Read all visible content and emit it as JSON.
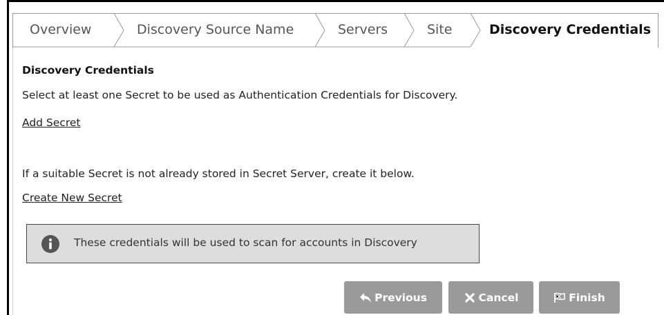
{
  "tabs": [
    {
      "label": "Overview"
    },
    {
      "label": "Discovery Source Name"
    },
    {
      "label": "Servers"
    },
    {
      "label": "Site"
    },
    {
      "label": "Discovery Credentials"
    }
  ],
  "active_tab_index": 4,
  "section": {
    "heading": "Discovery Credentials",
    "instruction": "Select at least one Secret to be used as Authentication Credentials for Discovery.",
    "add_secret_link": "Add Secret",
    "create_hint": "If a suitable Secret is not already stored in Secret Server, create it below.",
    "create_secret_link": "Create New Secret"
  },
  "info": {
    "icon": "info-icon",
    "text": "These credentials will be used to scan for accounts in Discovery"
  },
  "buttons": {
    "previous": "Previous",
    "cancel": "Cancel",
    "finish": "Finish"
  },
  "colors": {
    "button_bg": "#9a9a9a",
    "info_bg": "#dddddd",
    "info_icon": "#555555"
  }
}
